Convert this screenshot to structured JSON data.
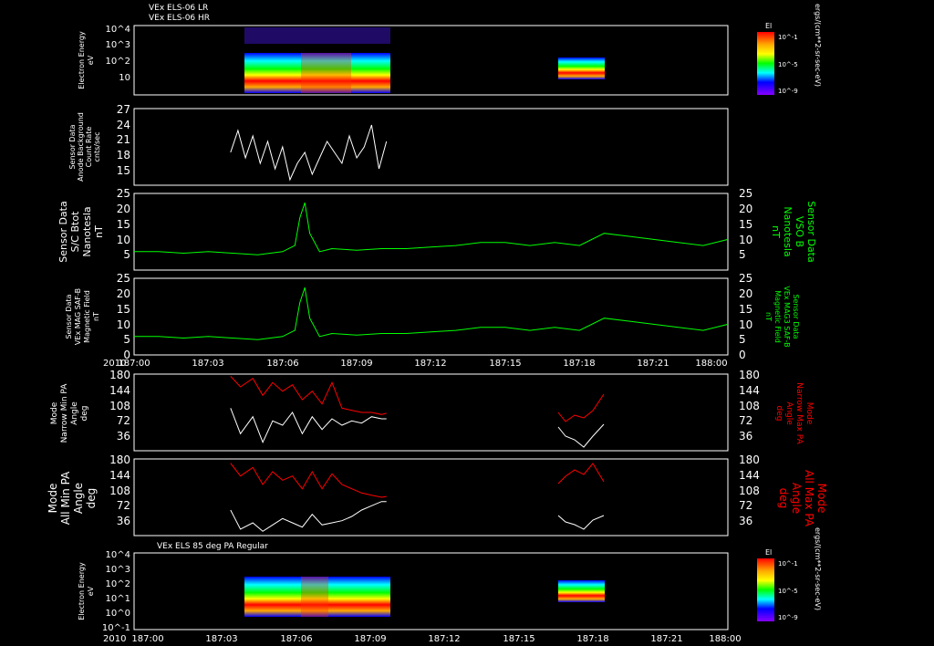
{
  "colors": {
    "background": "#000000",
    "white": "#ffffff",
    "green": "#00ff00",
    "red": "#ff0000",
    "gray": "#808080"
  },
  "panel1": {
    "titles": [
      "VEx ELS-06 LR",
      "VEx ELS-06 HR"
    ],
    "ylabel": [
      "Electron Energy",
      "eV"
    ],
    "yticks": [
      "10^4",
      "10^3",
      "10^2",
      "10"
    ],
    "colorbar": {
      "title": "El",
      "ticks": [
        "10^-1",
        "10^-5",
        "10^-9"
      ]
    },
    "units": "ergs/(cm**2-sr-sec-eV)"
  },
  "panel2": {
    "ylabel": [
      "Sensor Data",
      "Anode Background",
      "Count Rate",
      "cnts/sec"
    ],
    "yticks": [
      "27",
      "24",
      "21",
      "18",
      "15"
    ]
  },
  "panel3": {
    "ylabel_left": [
      "Sensor Data",
      "S/C Btot",
      "Nanotesla",
      "nT"
    ],
    "ylabel_right": [
      "Sensor Data",
      "VSO B",
      "Nanotesla",
      "nT"
    ],
    "yticks": [
      "25",
      "20",
      "15",
      "10",
      "5"
    ]
  },
  "panel4": {
    "ylabel_left": [
      "Sensor Data",
      "VEx MAG SAF-B",
      "Magnetic Field",
      "nT"
    ],
    "ylabel_right": [
      "Sensor Data",
      "VEx MAG3 SAF-B",
      "Magnetic Field",
      "nT"
    ],
    "yticks": [
      "25",
      "20",
      "15",
      "10",
      "5",
      "0"
    ]
  },
  "panel5": {
    "ylabel_left": [
      "Mode",
      "Narrow Min PA",
      "Angle",
      "deg"
    ],
    "ylabel_right": [
      "Mode",
      "Narrow Max PA",
      "Angle",
      "deg"
    ],
    "yticks": [
      "180",
      "144",
      "108",
      "72",
      "36"
    ]
  },
  "panel6": {
    "ylabel_left": [
      "Mode",
      "All Min PA",
      "Angle",
      "deg"
    ],
    "ylabel_right": [
      "Mode",
      "All Max PA",
      "Angle",
      "deg"
    ],
    "yticks": [
      "180",
      "144",
      "108",
      "72",
      "36"
    ]
  },
  "panel7": {
    "title": "VEx ELS 85 deg PA Regular",
    "ylabel": [
      "Electron Energy",
      "eV"
    ],
    "yticks": [
      "10^4",
      "10^3",
      "10^2",
      "10^1",
      "10^0",
      "10^-1"
    ],
    "colorbar": {
      "title": "El",
      "ticks": [
        "10^-1",
        "10^-5",
        "10^-9"
      ]
    },
    "units": "ergs/(cm**2-sr-sec-eV)"
  },
  "xaxis": {
    "year": "2010",
    "ticks": [
      "187:00",
      "187:03",
      "187:06",
      "187:09",
      "187:12",
      "187:15",
      "187:18",
      "187:21",
      "188:00"
    ]
  },
  "chart_data": [
    {
      "type": "heatmap",
      "title": "VEx ELS-06 LR / VEx ELS-06 HR",
      "ylabel": "Electron Energy eV",
      "yscale": "log",
      "ylim": [
        1,
        10000
      ],
      "x_range_start": [
        "187:03.9",
        "187:16.9"
      ],
      "x_range_end": [
        "187:10.2",
        "187:18.9"
      ]
    },
    {
      "type": "line",
      "ylabel": "Sensor Data Anode Background Count Rate cnts/sec",
      "ylim": [
        13,
        27
      ],
      "series": [
        {
          "x": [
            3.9,
            4.2,
            4.5,
            4.8,
            5.1,
            5.4,
            5.7,
            6.0,
            6.3,
            6.6,
            6.9,
            7.2,
            7.5,
            7.8,
            8.1,
            8.4,
            8.7,
            9.0,
            9.3,
            9.6,
            9.9,
            10.2
          ],
          "y": [
            19,
            23,
            18,
            22,
            17,
            21,
            16,
            20,
            14,
            17,
            19,
            15,
            18,
            21,
            19,
            17,
            22,
            18,
            20,
            24,
            16,
            21
          ]
        }
      ]
    },
    {
      "type": "line",
      "ylabel": "Sensor Data S/C Btot Nanotesla nT",
      "ylim": [
        0,
        25
      ],
      "series": [
        {
          "x": [
            0,
            1,
            2,
            3,
            4,
            5,
            6,
            6.5,
            6.7,
            6.9,
            7.1,
            7.5,
            8,
            9,
            10,
            11,
            12,
            13,
            14,
            15,
            16,
            17,
            18,
            19,
            20,
            21,
            22,
            23,
            24
          ],
          "y": [
            6,
            6,
            5.5,
            6,
            5.5,
            5,
            6,
            8,
            17,
            22,
            12,
            6,
            7,
            6.5,
            7,
            7,
            7.5,
            8,
            9,
            9,
            8,
            9,
            8,
            12,
            11,
            10,
            9,
            8,
            10
          ]
        }
      ]
    },
    {
      "type": "line",
      "ylabel": "Sensor Data VEx MAG SAF-B Magnetic Field nT",
      "ylim": [
        0,
        25
      ],
      "series": [
        {
          "x": [
            0,
            1,
            2,
            3,
            4,
            5,
            6,
            6.5,
            6.7,
            6.9,
            7.1,
            7.5,
            8,
            9,
            10,
            11,
            12,
            13,
            14,
            15,
            16,
            17,
            18,
            19,
            20,
            21,
            22,
            23,
            24
          ],
          "y": [
            6,
            6,
            5.5,
            6,
            5.5,
            5,
            6,
            8,
            17,
            22,
            12,
            6,
            7,
            6.5,
            7,
            7,
            7.5,
            8,
            9,
            9,
            8,
            9,
            8,
            12,
            11,
            10,
            9,
            8,
            10
          ]
        }
      ]
    },
    {
      "type": "line",
      "ylabel": "Mode Narrow Min PA Angle deg",
      "ylim": [
        0,
        180
      ],
      "series": [
        {
          "name": "Narrow Min PA",
          "x": [
            3.9,
            4.3,
            4.8,
            5.2,
            5.6,
            6.0,
            6.4,
            6.8,
            7.2,
            7.6,
            8.0,
            8.4,
            8.8,
            9.2,
            9.6,
            10.0,
            10.2
          ],
          "y": [
            100,
            40,
            80,
            20,
            70,
            60,
            90,
            40,
            80,
            50,
            75,
            60,
            70,
            65,
            80,
            75,
            75
          ]
        },
        {
          "name": "Narrow Max PA",
          "x": [
            3.9,
            4.3,
            4.8,
            5.2,
            5.6,
            6.0,
            6.4,
            6.8,
            7.2,
            7.6,
            8.0,
            8.4,
            8.8,
            9.2,
            9.6,
            10.0,
            10.2
          ],
          "y": [
            175,
            150,
            170,
            130,
            160,
            140,
            155,
            120,
            140,
            110,
            160,
            100,
            95,
            90,
            90,
            85,
            88
          ]
        }
      ]
    },
    {
      "type": "line",
      "ylabel": "Mode All Min PA Angle deg",
      "ylim": [
        0,
        180
      ],
      "series": [
        {
          "name": "All Min PA",
          "x": [
            3.9,
            4.3,
            4.8,
            5.2,
            5.6,
            6.0,
            6.4,
            6.8,
            7.2,
            7.6,
            8.0,
            8.4,
            8.8,
            9.2,
            9.6,
            10.0,
            10.2
          ],
          "y": [
            60,
            15,
            30,
            10,
            25,
            40,
            30,
            20,
            50,
            25,
            30,
            35,
            45,
            60,
            70,
            80,
            80
          ]
        },
        {
          "name": "All Max PA",
          "x": [
            3.9,
            4.3,
            4.8,
            5.2,
            5.6,
            6.0,
            6.4,
            6.8,
            7.2,
            7.6,
            8.0,
            8.4,
            8.8,
            9.2,
            9.6,
            10.0,
            10.2
          ],
          "y": [
            170,
            140,
            160,
            120,
            150,
            130,
            140,
            110,
            150,
            110,
            145,
            120,
            110,
            100,
            95,
            90,
            92
          ]
        }
      ]
    },
    {
      "type": "heatmap",
      "title": "VEx ELS 85 deg PA Regular",
      "ylabel": "Electron Energy eV",
      "yscale": "log",
      "ylim": [
        0.1,
        10000
      ],
      "x_range_start": [
        "187:03.9",
        "187:16.9"
      ],
      "x_range_end": [
        "187:10.2",
        "187:18.9"
      ]
    }
  ]
}
